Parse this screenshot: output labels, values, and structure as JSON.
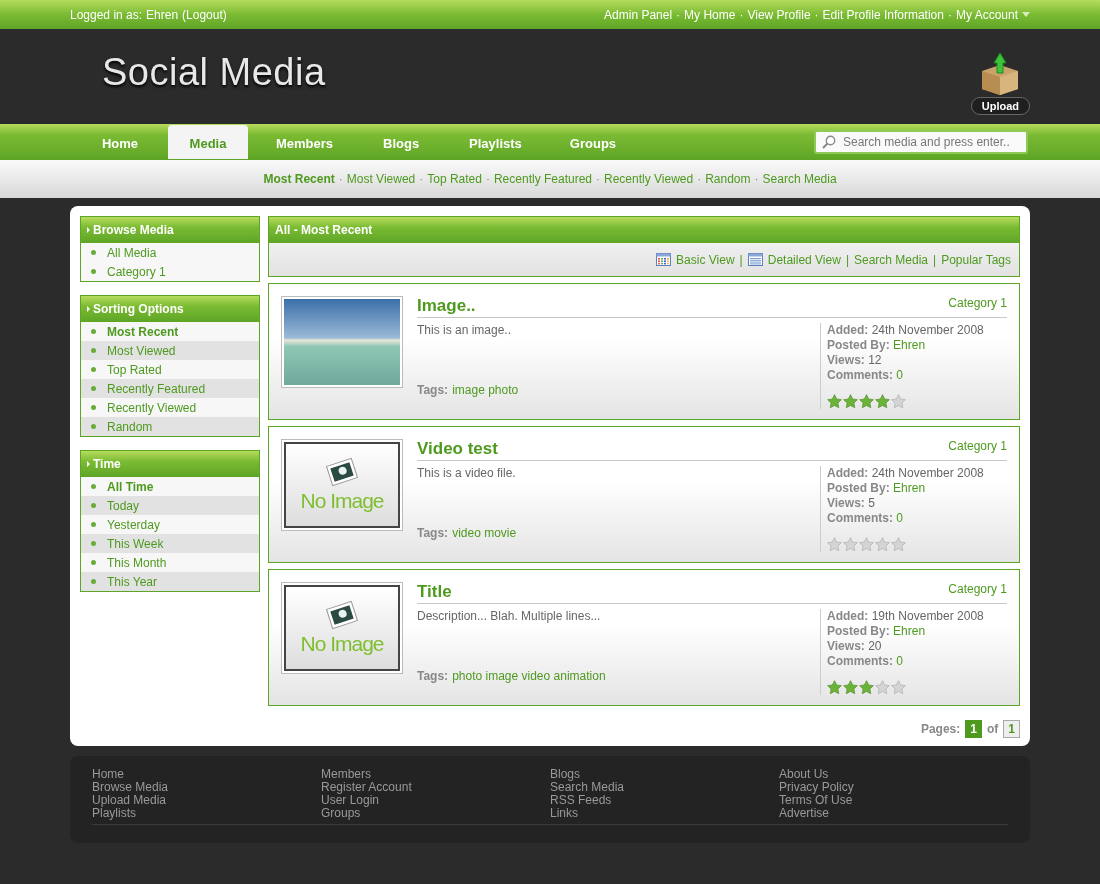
{
  "top_bar": {
    "login_label": "Logged in as:",
    "user": "Ehren",
    "logout": "(Logout)",
    "separator": "·",
    "account_links": [
      "Admin Panel",
      "My Home",
      "View Profile",
      "Edit Profile Information",
      "My Account"
    ]
  },
  "header": {
    "logo": "Social Media",
    "upload": "Upload"
  },
  "nav": {
    "tabs": [
      {
        "label": "Home",
        "selected": false
      },
      {
        "label": "Media",
        "selected": true
      },
      {
        "label": "Members",
        "selected": false
      },
      {
        "label": "Blogs",
        "selected": false
      },
      {
        "label": "Playlists",
        "selected": false
      },
      {
        "label": "Groups",
        "selected": false
      }
    ],
    "search": {
      "placeholder": "Search media and press enter.."
    }
  },
  "sub_nav": {
    "separator": "·",
    "items": [
      {
        "label": "Most Recent",
        "selected": true
      },
      {
        "label": "Most Viewed",
        "selected": false
      },
      {
        "label": "Top Rated",
        "selected": false
      },
      {
        "label": "Recently Featured",
        "selected": false
      },
      {
        "label": "Recently Viewed",
        "selected": false
      },
      {
        "label": "Random",
        "selected": false
      },
      {
        "label": "Search Media",
        "selected": false
      }
    ]
  },
  "sidebar": [
    {
      "title": "Browse Media",
      "items": [
        {
          "label": "All Media",
          "selected": false
        },
        {
          "label": "Category 1",
          "selected": false
        }
      ]
    },
    {
      "title": "Sorting Options",
      "items": [
        {
          "label": "Most Recent",
          "selected": true
        },
        {
          "label": "Most Viewed",
          "selected": false
        },
        {
          "label": "Top Rated",
          "selected": false
        },
        {
          "label": "Recently Featured",
          "selected": false
        },
        {
          "label": "Recently Viewed",
          "selected": false
        },
        {
          "label": "Random",
          "selected": false
        }
      ]
    },
    {
      "title": "Time",
      "items": [
        {
          "label": "All Time",
          "selected": true
        },
        {
          "label": "Today",
          "selected": false
        },
        {
          "label": "Yesterday",
          "selected": false
        },
        {
          "label": "This Week",
          "selected": false
        },
        {
          "label": "This Month",
          "selected": false
        },
        {
          "label": "This Year",
          "selected": false
        }
      ]
    }
  ],
  "main": {
    "title": "All - Most Recent",
    "separator": "|",
    "view_links": [
      {
        "label": "Basic View",
        "kind": "grid"
      },
      {
        "label": "Detailed View",
        "kind": "list"
      },
      {
        "label": "Search Media",
        "kind": "plain"
      },
      {
        "label": "Popular Tags",
        "kind": "plain"
      }
    ],
    "media": [
      {
        "title": "Image..",
        "thumbnail": {
          "kind": "photo"
        },
        "category": "Category 1",
        "description": "This is an image..",
        "tags_label": "Tags:",
        "tags": "image photo",
        "meta": [
          {
            "label": "Added:",
            "value": "24th November 2008",
            "kind": "text"
          },
          {
            "label": "Posted By:",
            "value": "Ehren",
            "kind": "link"
          },
          {
            "label": "Views:",
            "value": "12",
            "kind": "text"
          },
          {
            "label": "Comments:",
            "value": "0",
            "kind": "link"
          }
        ],
        "stars": 4
      },
      {
        "title": "Video test",
        "thumbnail": {
          "kind": "none",
          "text": "No Image"
        },
        "category": "Category 1",
        "description": "This is a video file.",
        "tags_label": "Tags:",
        "tags": "video movie",
        "meta": [
          {
            "label": "Added:",
            "value": "24th November 2008",
            "kind": "text"
          },
          {
            "label": "Posted By:",
            "value": "Ehren",
            "kind": "link"
          },
          {
            "label": "Views:",
            "value": "5",
            "kind": "text"
          },
          {
            "label": "Comments:",
            "value": "0",
            "kind": "link"
          }
        ],
        "stars": 0
      },
      {
        "title": "Title",
        "thumbnail": {
          "kind": "none",
          "text": "No Image"
        },
        "category": "Category 1",
        "description": "Description... Blah. Multiple lines...",
        "tags_label": "Tags:",
        "tags": "photo image video animation",
        "meta": [
          {
            "label": "Added:",
            "value": "19th November 2008",
            "kind": "text"
          },
          {
            "label": "Posted By:",
            "value": "Ehren",
            "kind": "link"
          },
          {
            "label": "Views:",
            "value": "20",
            "kind": "text"
          },
          {
            "label": "Comments:",
            "value": "0",
            "kind": "link"
          }
        ],
        "stars": 3
      }
    ],
    "pagination": {
      "label": "Pages:",
      "current": "1",
      "of": "of",
      "total": "1"
    }
  },
  "footer": [
    [
      "Home",
      "Browse Media",
      "Upload Media",
      "Playlists"
    ],
    [
      "Members",
      "Register Account",
      "User Login",
      "Groups"
    ],
    [
      "Blogs",
      "Search Media",
      "RSS Feeds",
      "Links"
    ],
    [
      "About Us",
      "Privacy Policy",
      "Terms Of Use",
      "Advertise"
    ]
  ]
}
